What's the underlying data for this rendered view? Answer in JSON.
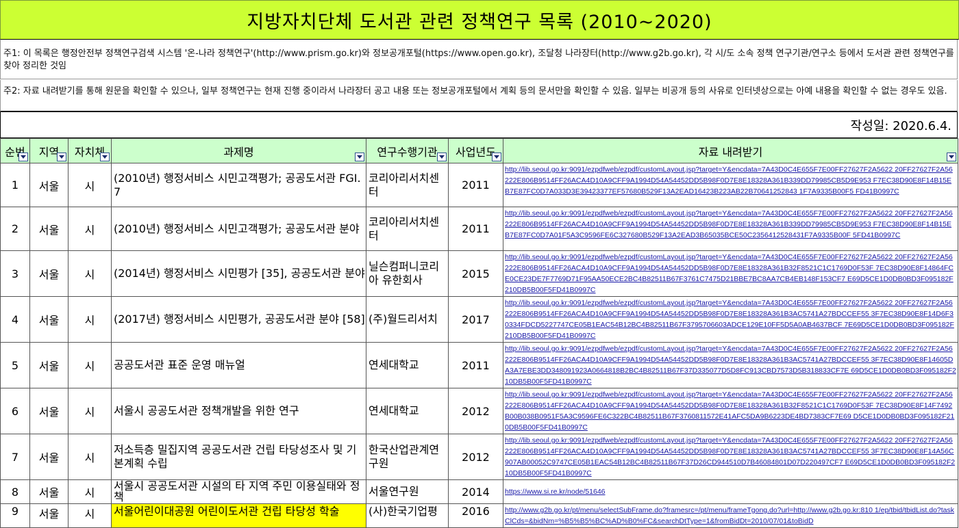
{
  "title": "지방자치단체 도서관 관련 정책연구 목록 (2010~2020)",
  "notes": [
    "주1: 이 목록은 행정안전부 정책연구검색 시스템 '온-나라 정책연구'(http://www.prism.go.kr)와 정보공개포털(https://www.open.go.kr), 조달청 나라장터(http://www.g2b.go.kr), 각 시/도 소속 정책 연구기관/연구소 등에서 도서관 관련 정책연구를 찾아 정리한 것임",
    "주2: 자료 내려받기를 통해 원문을 확인할 수 있으나, 일부 정책연구는 현재 진행 중이라서 나라장터 공고 내용 또는 정보공개포털에서 계획 등의 문서만을 확인할 수 있음. 일부는 비공개 등의 사유로 인터넷상으로는 아예 내용을 확인할 수 없는 경우도 있음."
  ],
  "date_label": "작성일: 2020.6.4.",
  "headers": [
    "순번",
    "지역",
    "자치체",
    "과제명",
    "연구수행기관",
    "사업년도",
    "자료 내려받기"
  ],
  "rows": [
    {
      "no": "1",
      "region": "서울",
      "gov": "시",
      "project": "(2010년) 행정서비스 시민고객평가; 공공도서관 FGI. 7",
      "org": "코리아리서치센터",
      "year": "2011",
      "link": "http://lib.seoul.go.kr:9091/ezpdfweb/ezpdf/customLayout.jsp?target=Y&encdata=7A43D0C4E655F7E00FF27627F2A5622 20FF27627F2A56222E806B9514FF26ACA4D10A9CFF9A1994D54A54452DD5B98F0D7E8E18328A361B339DD79985CB5D9E953 F7EC38D90E8F14B15EB7E87FC0D7A033D3E39423377EF57680B529F13A2EAD16423B223AB22B70641252843 1F7A9335B00F5 FD41B0997C"
    },
    {
      "no": "2",
      "region": "서울",
      "gov": "시",
      "project": "(2010년) 행정서비스 시민고객평가; 공공도서관 분야",
      "org": "코리아리서치센터",
      "year": "2011",
      "link": "http://lib.seoul.go.kr:9091/ezpdfweb/ezpdf/customLayout.jsp?target=Y&encdata=7A43D0C4E655F7E00FF27627F2A5622 20FF27627F2A56222E806B9514FF26ACA4D10A9CFF9A1994D54A54452DD5B98F0D7E8E18328A361B339DD79985CB5D9E953 F7EC38D90E8F14B15EB7E87FC0D7A01F5A3C9596FE6C327680B529F13A2EAD3B65035BCE50C2356412528431F7A9335B00F 5FD41B0997C"
    },
    {
      "no": "3",
      "region": "서울",
      "gov": "시",
      "project": "(2014년) 행정서비스 시민평가 [35], 공공도서관 분야",
      "org": "닐슨컴퍼니코리아 유한회사",
      "year": "2015",
      "link": "http://lib.seoul.go.kr:9091/ezpdfweb/ezpdf/customLayout.jsp?target=Y&encdata=7A43D0C4E655F7E00FF27627F2A5622 20FF27627F2A56222E806B9514FF26ACA4D10A9CFF9A1994D54A54452DD5B98F0D7E8E18328A361B32F8521C1C1769D0F53F 7EC38D90E8F14864FCE0CE23DE7F7769D71F95AA50ECE2BC4B82511B67F3761C7475D21BBE7BC8AA7CB4EB148F153CF7 E69D5CE1D0DB0BD3F095182F210DB5B00F5FD41B0997C"
    },
    {
      "no": "4",
      "region": "서울",
      "gov": "시",
      "project": "(2017년) 행정서비스 시민평가, 공공도서관 분야 [58]",
      "org": "(주)월드리서치",
      "year": "2017",
      "link": "http://lib.seoul.go.kr:9091/ezpdfweb/ezpdf/customLayout.jsp?target=Y&encdata=7A43D0C4E655F7E00FF27627F2A5622 20FF27627F2A56222E806B9514FF26ACA4D10A9CFF9A1994D54A54452DD5B98F0D7E8E18328A361B3AC5741A27BDCCEF55 3F7EC38D90E8F14D6F30334FDCD5227747CE05B1EAC54B12BC4B82511B67F3795706603ADCE129E10FF5D5A0AB4637BCF 7E69D5CE1D0DB0BD3F095182F210DB5B00F5FD41B0997C"
    },
    {
      "no": "5",
      "region": "서울",
      "gov": "시",
      "project": "공공도서관 표준 운영 매뉴얼",
      "org": "연세대학교",
      "year": "2011",
      "link": "http://lib.seoul.go.kr:9091/ezpdfweb/ezpdf/customLayout.jsp?target=Y&encdata=7A43D0C4E655F7E00FF27627F2A5622 20FF27627F2A56222E806B9514FF26ACA4D10A9CFF9A1994D54A54452DD5B98F0D7E8E18328A361B3AC5741A27BDCCEF55 3F7EC38D90E8F14605DA3A7EBE3DD348091923A0664818B2BC4B82511B67F37D335077D5D8FC913CBD7573D5B318833CF7E 69D5CE1D0DB0BD3F095182F210DB5B00F5FD41B0997C"
    },
    {
      "no": "6",
      "region": "서울",
      "gov": "시",
      "project": "서울시 공공도서관 정책개발을 위한 연구",
      "org": "연세대학교",
      "year": "2012",
      "link": "http://lib.seoul.go.kr:9091/ezpdfweb/ezpdf/customLayout.jsp?target=Y&encdata=7A43D0C4E655F7E00FF27627F2A5622 20FF27627F2A56222E806B9514FF26ACA4D10A9CFF9A1994D54A54452DD5B98F0D7E8E18328A361B32F8521C1C1769D0F53F 7EC38D90E8F14F7492B00B038B0951F5A3C9596FE6C322BC4B82511B67F3760811572E41AFC5DA9B6223DE4BD7383CF7E69 D5CE1D0DB0BD3F095182F210DB5B00F5FD41B0997C"
    },
    {
      "no": "7",
      "region": "서울",
      "gov": "시",
      "project": "저소득층 밀집지역 공공도서관 건립 타당성조사 및 기본계획 수립",
      "org": "한국산업관계연구원",
      "year": "2012",
      "link": "http://lib.seoul.go.kr:9091/ezpdfweb/ezpdf/customLayout.jsp?target=Y&encdata=7A43D0C4E655F7E00FF27627F2A5622 20FF27627F2A56222E806B9514FF26ACA4D10A9CFF9A1994D54A54452DD5B98F0D7E8E18328A361B3AC5741A27BDCCEF55 3F7EC38D90E8F14A56C907AB00052C9747CE05B1EAC54B12BC4B82511B67F37D26CD944510D7B46084801D07D220497CF7 E69D5CE1D0DB0BD3F095182F210DB5B00F5FD41B0997C"
    },
    {
      "no": "8",
      "region": "서울",
      "gov": "시",
      "project": "서울시 공공도서관 시설의 타 지역 주민 이용실태와 정책",
      "org": "서울연구원",
      "year": "2014",
      "link": "https://www.si.re.kr/node/51646"
    },
    {
      "no": "9",
      "region": "서울",
      "gov": "시",
      "project": "서울어린이대공원 어린이도서관 건립 타당성 학술",
      "org": "(사)한국기업평",
      "year": "2016",
      "link": "http://www.g2b.go.kr/pt/menu/selectSubFrame.do?framesrc=/pt/menu/frameTgong.do?url=http://www.g2b.go.kr:810 1/ep/tbid/tbidList.do?taskClCds=&bidNm=%B5%B5%BC%AD%B0%FC&searchDtType=1&fromBidDt=2010/07/01&toBidD"
    }
  ]
}
